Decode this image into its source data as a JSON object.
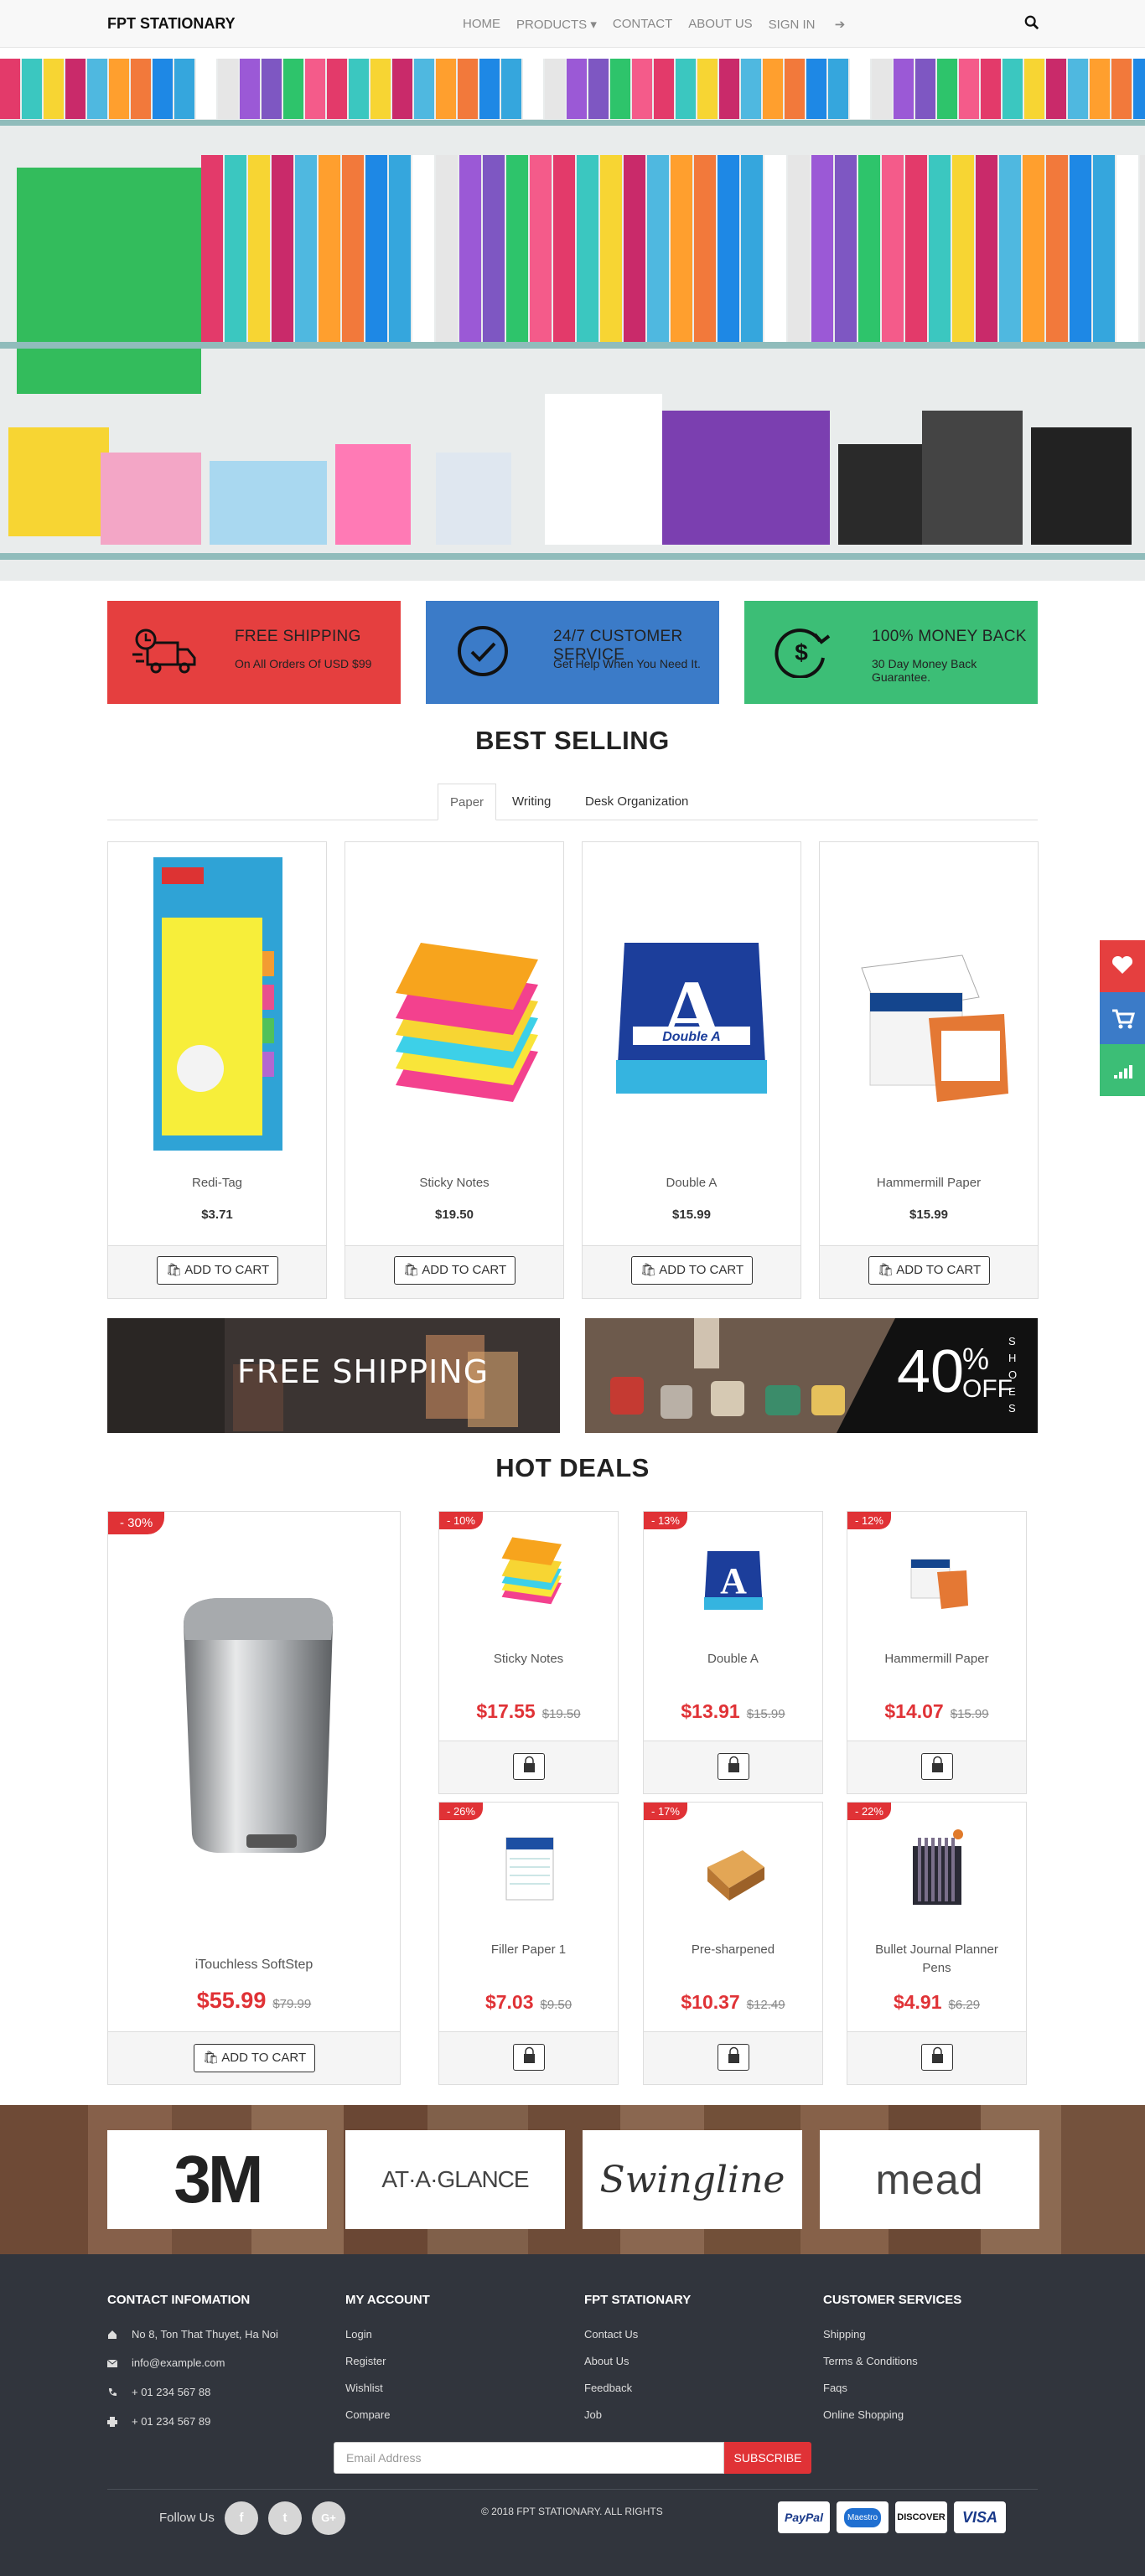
{
  "nav": {
    "brand": "FPT STATIONARY",
    "items": [
      "HOME",
      "PRODUCTS ▾",
      "CONTACT",
      "ABOUT US",
      "SIGN IN"
    ]
  },
  "features": [
    {
      "title": "FREE SHIPPING",
      "subtitle": "On All Orders Of USD $99",
      "color": "#e53f3f",
      "icon": "truck-clock-icon"
    },
    {
      "title": "24/7 CUSTOMER SERVICE",
      "subtitle": "Get Help When You Need It.",
      "color": "#3b7bc8",
      "icon": "checkmark-circle-icon"
    },
    {
      "title": "100% MONEY BACK",
      "subtitle": "30 Day Money Back Guarantee.",
      "color": "#3cbe76",
      "icon": "dollar-refresh-icon"
    }
  ],
  "best_selling": {
    "title": "BEST SELLING",
    "tabs": [
      "Paper",
      "Writing",
      "Desk Organization"
    ],
    "products": [
      {
        "name": "Redi-Tag",
        "price": "$3.71"
      },
      {
        "name": "Sticky Notes",
        "price": "$19.50"
      },
      {
        "name": "Double A",
        "price": "$15.99"
      },
      {
        "name": "Hammermill Paper",
        "price": "$15.99"
      }
    ],
    "add_to_cart": "ADD TO CART"
  },
  "banners": {
    "left": "FREE SHIPPING",
    "right_big": "40",
    "right_pct": "%",
    "right_off": "OFF",
    "right_side": "SHOES"
  },
  "hot_deals": {
    "title": "HOT DEALS",
    "add_to_cart": "ADD TO CART",
    "featured": {
      "badge": "- 30%",
      "name": "iTouchless SoftStep",
      "price": "$55.99",
      "old": "$79.99"
    },
    "items": [
      {
        "badge": "- 10%",
        "name": "Sticky Notes",
        "price": "$17.55",
        "old": "$19.50"
      },
      {
        "badge": "- 13%",
        "name": "Double A",
        "price": "$13.91",
        "old": "$15.99"
      },
      {
        "badge": "- 12%",
        "name": "Hammermill Paper",
        "price": "$14.07",
        "old": "$15.99"
      },
      {
        "badge": "- 26%",
        "name": "Filler Paper 1",
        "price": "$7.03",
        "old": "$9.50"
      },
      {
        "badge": "- 17%",
        "name": "Pre-sharpened",
        "price": "$10.37",
        "old": "$12.49"
      },
      {
        "badge": "- 22%",
        "name": "Bullet Journal Planner Pens",
        "price": "$4.91",
        "old": "$6.29"
      }
    ]
  },
  "brands": [
    "3M",
    "AT·A·GLANCE",
    "Swingline",
    "mead"
  ],
  "footer": {
    "contact": {
      "title": "CONTACT INFOMATION",
      "address": "No 8, Ton That Thuyet, Ha Noi",
      "email": "info@example.com",
      "phone": "+ 01 234 567 88",
      "fax": "+ 01 234 567 89"
    },
    "account": {
      "title": "MY ACCOUNT",
      "links": [
        "Login",
        "Register",
        "Wishlist",
        "Compare"
      ]
    },
    "company": {
      "title": "FPT STATIONARY",
      "links": [
        "Contact Us",
        "About Us",
        "Feedback",
        "Job"
      ]
    },
    "service": {
      "title": "CUSTOMER SERVICES",
      "links": [
        "Shipping",
        "Terms & Conditions",
        "Faqs",
        "Online Shopping"
      ]
    },
    "email_placeholder": "Email Address",
    "subscribe": "SUBSCRIBE",
    "follow": "Follow Us",
    "social": [
      "f",
      "t",
      "G+"
    ],
    "copyright": "© 2018 FPT STATIONARY. ALL RIGHTS",
    "payments": [
      "PayPal",
      "Maestro",
      "DISCOVER",
      "VISA"
    ]
  }
}
